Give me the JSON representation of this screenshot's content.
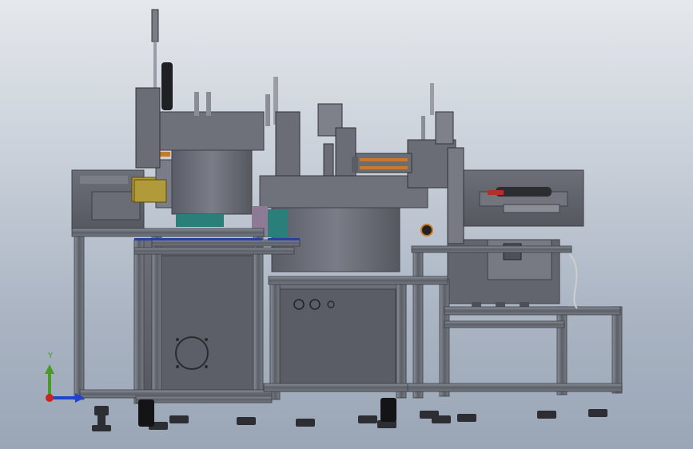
{
  "viewport": {
    "background_top": "#e5e8ec",
    "background_bottom": "#9aa6b6"
  },
  "model": {
    "description_icon": "assembly-machine-3d-model",
    "frame_color": "#5f636c",
    "frame_highlight": "#8b8f98",
    "panel_color": "#5e6068",
    "panel_light": "#777a83",
    "accent_teal": "#2a7f7a",
    "accent_orange": "#c77a2a",
    "accent_blue": "#2b3fa0",
    "accent_red": "#b0302a"
  },
  "triad": {
    "y_label": "Y",
    "y_color": "#4a9a2a",
    "x_color": "#2244cc",
    "z_color": "#cc2222"
  }
}
